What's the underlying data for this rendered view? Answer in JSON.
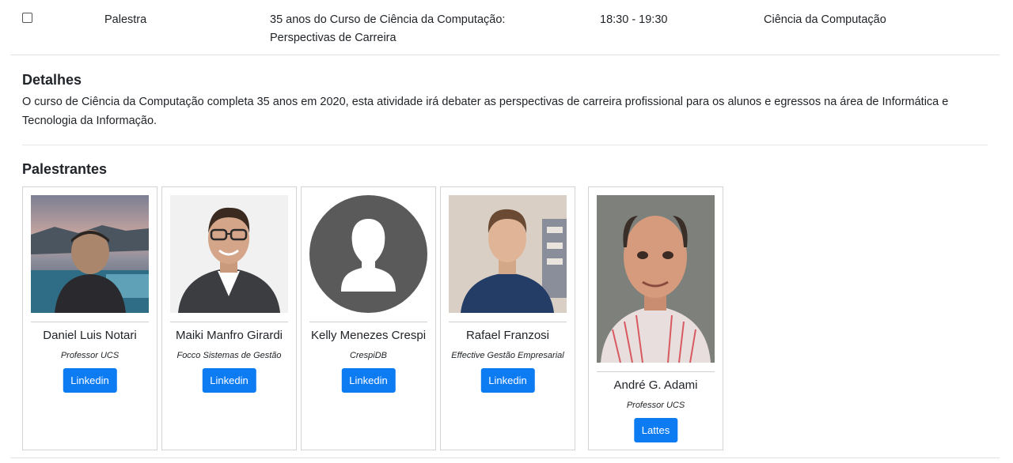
{
  "event": {
    "type": "Palestra",
    "title": "35 anos do Curso de Ciência da Computação: Perspectivas de Carreira",
    "time": "18:30 - 19:30",
    "course": "Ciência da Computação"
  },
  "details": {
    "heading": "Detalhes",
    "text": "O curso de Ciência da Computação completa 35 anos em 2020, esta atividade irá debater as perspectivas de carreira profissional para os alunos e egressos na área de Informática e Tecnologia da Informação."
  },
  "speakers": {
    "heading": "Palestrantes",
    "items": [
      {
        "name": "Daniel Luis Notari",
        "org": "Professor UCS",
        "button": "Linkedin"
      },
      {
        "name": "Maiki Manfro Girardi",
        "org": "Focco Sistemas de Gestão",
        "button": "Linkedin"
      },
      {
        "name": "Kelly Menezes Crespi",
        "org": "CrespiDB",
        "button": "Linkedin"
      },
      {
        "name": "Rafael Franzosi",
        "org": "Effective Gestão Empresarial",
        "button": "Linkedin"
      },
      {
        "name": "André G. Adami",
        "org": "Professor UCS",
        "button": "Lattes"
      }
    ]
  },
  "colors": {
    "button": "#0d7cf2",
    "border": "#dee2e6"
  }
}
